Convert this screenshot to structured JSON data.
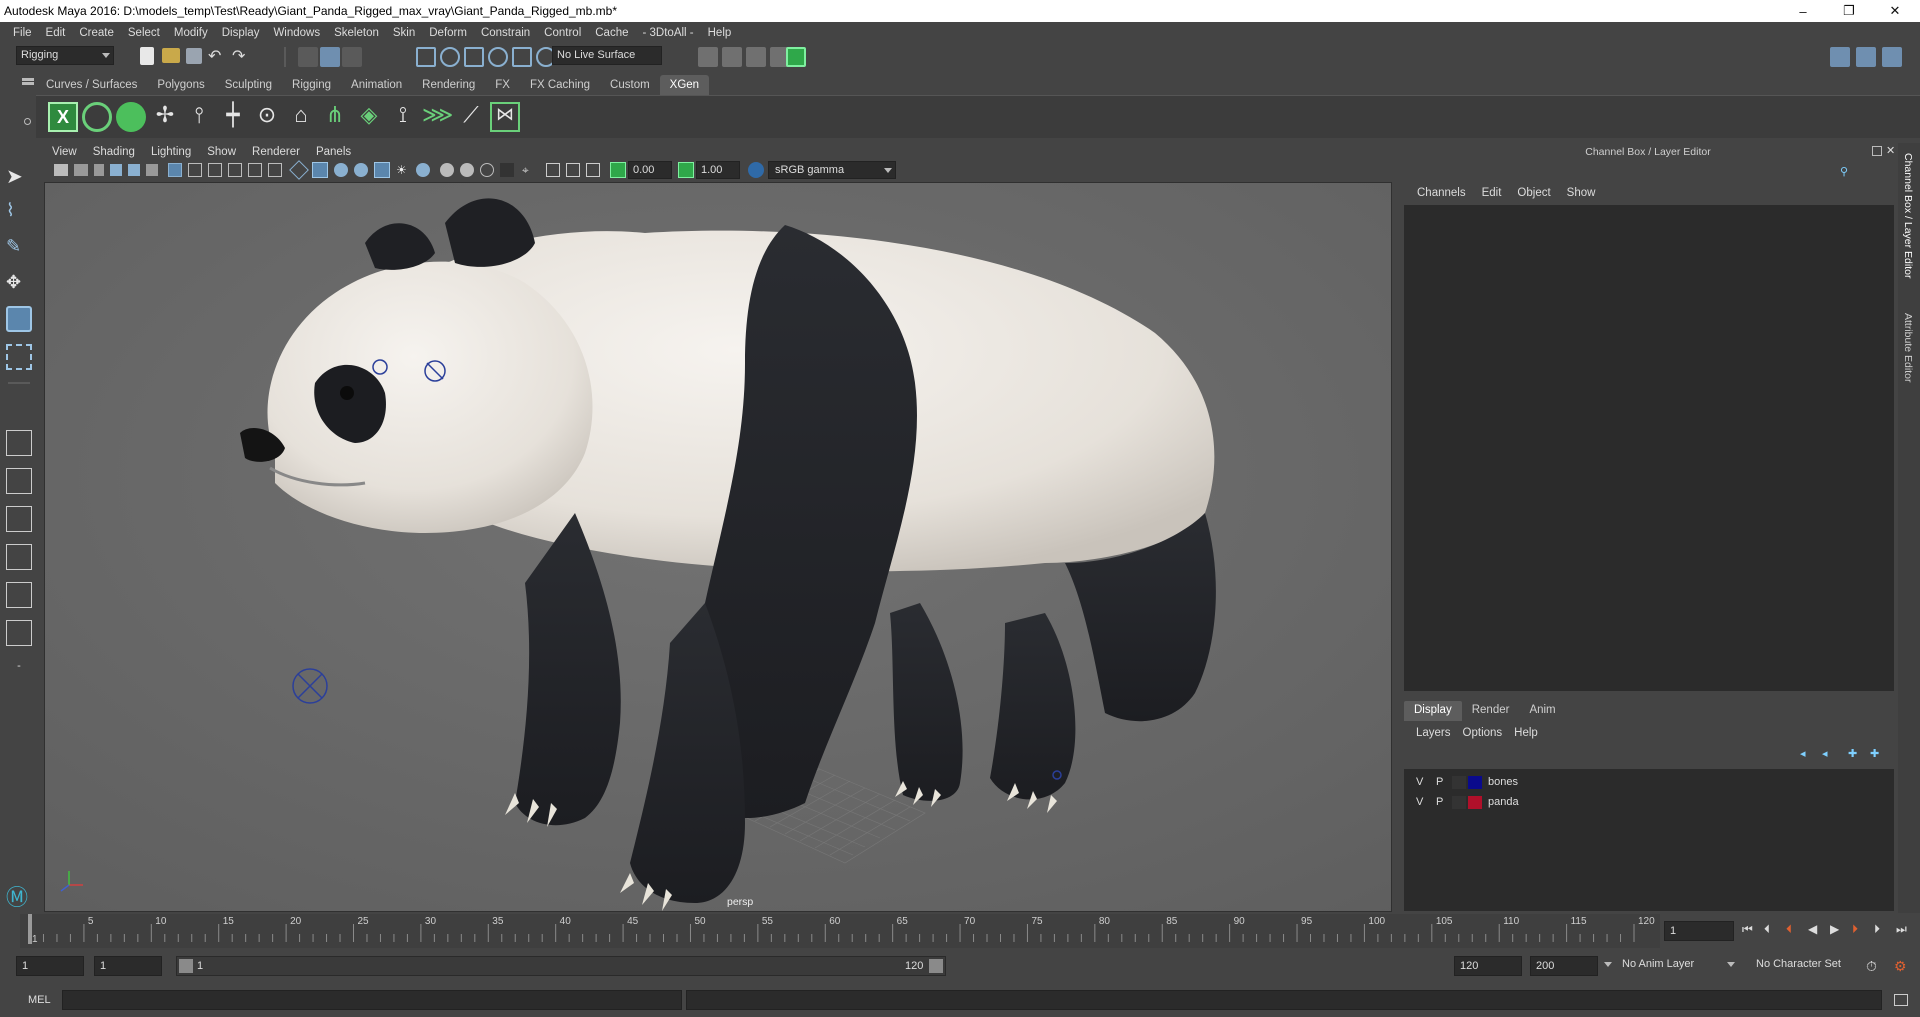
{
  "window": {
    "title": "Autodesk Maya 2016: D:\\models_temp\\Test\\Ready\\Giant_Panda_Rigged_max_vray\\Giant_Panda_Rigged_mb.mb*",
    "minimize": "–",
    "maximize": "❐",
    "close": "✕"
  },
  "menubar": [
    "File",
    "Edit",
    "Create",
    "Select",
    "Modify",
    "Display",
    "Windows",
    "Skeleton",
    "Skin",
    "Deform",
    "Constrain",
    "Control",
    "Cache",
    "- 3DtoAll -",
    "Help"
  ],
  "statusline": {
    "menuset": "Rigging",
    "live_surface": "No Live Surface"
  },
  "shelf": {
    "tabs": [
      "Curves / Surfaces",
      "Polygons",
      "Sculpting",
      "Rigging",
      "Animation",
      "Rendering",
      "FX",
      "FX Caching",
      "Custom",
      "XGen"
    ],
    "active_tab": "XGen"
  },
  "viewport": {
    "menu": [
      "View",
      "Shading",
      "Lighting",
      "Show",
      "Renderer",
      "Panels"
    ],
    "exposure": "0.00",
    "gamma": "1.00",
    "color_space": "sRGB gamma",
    "camera_label": "persp"
  },
  "channel_box": {
    "header": "Channel Box / Layer Editor",
    "menu": [
      "Channels",
      "Edit",
      "Object",
      "Show"
    ]
  },
  "layer_editor": {
    "tabs": [
      "Display",
      "Render",
      "Anim"
    ],
    "active_tab": "Display",
    "menu": [
      "Layers",
      "Options",
      "Help"
    ],
    "layers": [
      {
        "v": "V",
        "p": "P",
        "name": "bones",
        "color": "#0a0a8c"
      },
      {
        "v": "V",
        "p": "P",
        "name": "panda",
        "color": "#b0102a"
      }
    ]
  },
  "side_tabs": [
    "Channel Box / Layer Editor",
    "Attribute Editor"
  ],
  "timeslider": {
    "ticks": [
      "1",
      "5",
      "10",
      "15",
      "20",
      "25",
      "30",
      "35",
      "40",
      "45",
      "50",
      "55",
      "60",
      "65",
      "70",
      "75",
      "80",
      "85",
      "90",
      "95",
      "100",
      "105",
      "110",
      "115",
      "120"
    ],
    "current_frame": "1"
  },
  "range": {
    "start": "1",
    "playback_start": "1",
    "range_start_label": "1",
    "range_end_label": "120",
    "playback_end": "120",
    "end": "200",
    "anim_layer": "No Anim Layer",
    "character_set": "No Character Set"
  },
  "command": {
    "label": "MEL"
  }
}
